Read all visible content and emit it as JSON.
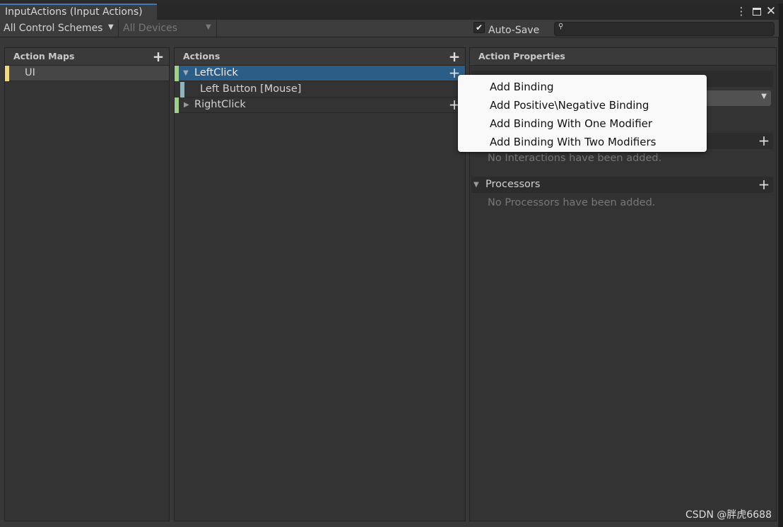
{
  "window": {
    "tab_title": "InputActions (Input Actions)",
    "more_icon": "kebab-menu-icon",
    "maximize_icon": "maximize-icon",
    "close_icon": "close-icon"
  },
  "toolbar": {
    "control_schemes": "All Control Schemes",
    "devices": "All Devices",
    "auto_save_label": "Auto-Save",
    "auto_save_checked": true,
    "search_value": ""
  },
  "action_maps": {
    "header": "Action Maps",
    "items": [
      {
        "label": "UI",
        "color": "#f2d97e"
      }
    ]
  },
  "actions": {
    "header": "Actions",
    "items": [
      {
        "label": "LeftClick",
        "expanded": true,
        "selected": true,
        "color": "#a1d08c"
      },
      {
        "label": "Left Button [Mouse]",
        "binding": true,
        "color": "#8fb5bf"
      },
      {
        "label": "RightClick",
        "expanded": false,
        "color": "#a1d08c"
      }
    ]
  },
  "properties": {
    "header": "Action Properties",
    "interactions_header": "",
    "interactions_empty": "No Interactions have been added.",
    "processors_header": "Processors",
    "processors_empty": "No Processors have been added."
  },
  "context_menu": {
    "items": [
      "Add Binding",
      "Add Positive\\Negative Binding",
      "Add Binding With One Modifier",
      "Add Binding With Two Modifiers"
    ]
  },
  "watermark": "CSDN @胖虎6688",
  "colors": {
    "selection": "#2c5d87",
    "background": "#383838",
    "panel": "#333333"
  }
}
